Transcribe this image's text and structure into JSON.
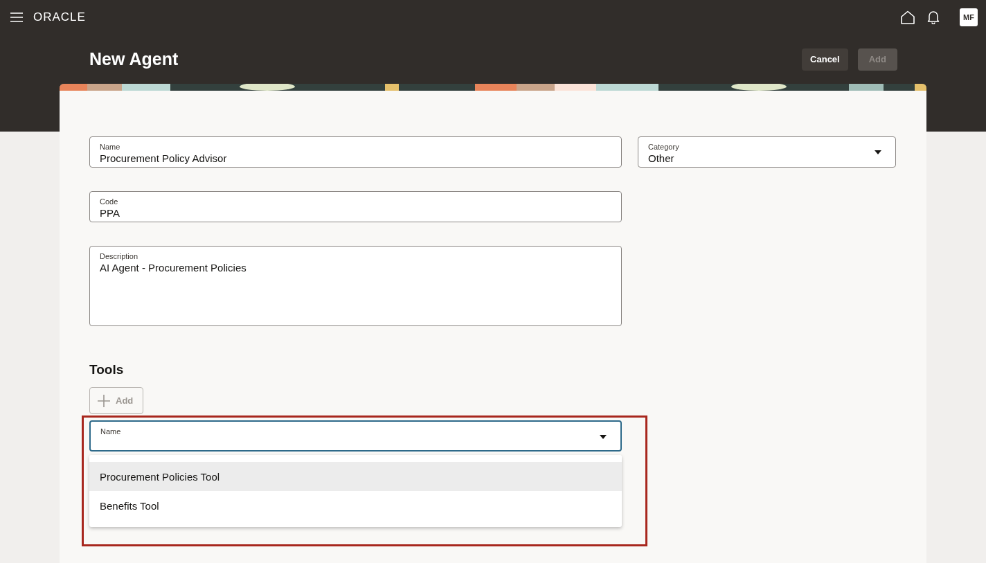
{
  "topbar": {
    "logo": "ORACLE",
    "avatar": "MF"
  },
  "page": {
    "title": "New Agent",
    "buttons": [
      {
        "label": "Cancel",
        "disabled": false
      },
      {
        "label": "Add",
        "disabled": true
      }
    ]
  },
  "form": {
    "name": {
      "label": "Name",
      "value": "Procurement Policy Advisor"
    },
    "category": {
      "label": "Category",
      "value": "Other"
    },
    "code": {
      "label": "Code",
      "value": "PPA"
    },
    "description": {
      "label": "Description",
      "value": "AI Agent - Procurement Policies"
    }
  },
  "tools": {
    "heading": "Tools",
    "add_button": {
      "label": "Add",
      "disabled": true
    },
    "select": {
      "label": "Name",
      "focused": true,
      "expanded": true
    },
    "options": [
      {
        "label": "Procurement Policies Tool",
        "selected": true
      },
      {
        "label": "Benefits Tool",
        "selected": false
      }
    ],
    "highlight_frame": true
  }
}
